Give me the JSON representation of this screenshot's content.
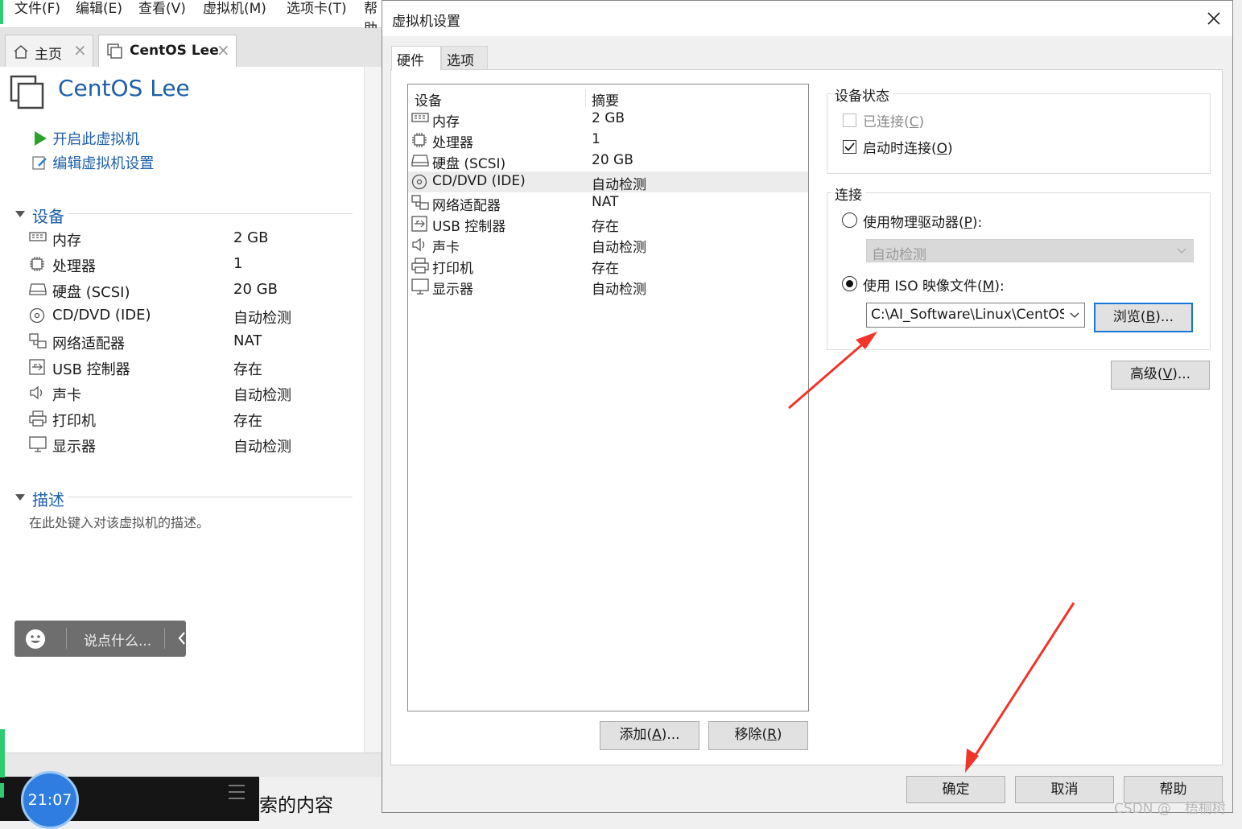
{
  "menubar": {
    "items": [
      "文件(F)",
      "编辑(E)",
      "查看(V)",
      "虚拟机(M)",
      "选项卡(T)",
      "帮助"
    ]
  },
  "tabs": [
    {
      "label": "主页"
    },
    {
      "label": "CentOS Lee"
    }
  ],
  "vm": {
    "title": "CentOS Lee",
    "actions": {
      "start": "开启此虚拟机",
      "edit": "编辑虚拟机设置"
    },
    "devices_title": "设备",
    "devices": [
      {
        "name": "内存",
        "value": "2 GB"
      },
      {
        "name": "处理器",
        "value": "1"
      },
      {
        "name": "硬盘 (SCSI)",
        "value": "20 GB"
      },
      {
        "name": "CD/DVD (IDE)",
        "value": "自动检测"
      },
      {
        "name": "网络适配器",
        "value": "NAT"
      },
      {
        "name": "USB 控制器",
        "value": "存在"
      },
      {
        "name": "声卡",
        "value": "自动检测"
      },
      {
        "name": "打印机",
        "value": "存在"
      },
      {
        "name": "显示器",
        "value": "自动检测"
      }
    ],
    "description_title": "描述",
    "description_placeholder": "在此处键入对该虚拟机的描述。"
  },
  "chat": {
    "placeholder": "说点什么..."
  },
  "taskbar": {
    "clock": "21:07",
    "search_text": "索的内容"
  },
  "dialog": {
    "title": "虚拟机设置",
    "tabs": {
      "hardware": "硬件",
      "options": "选项"
    },
    "list_headers": {
      "device": "设备",
      "summary": "摘要"
    },
    "devices": [
      {
        "name": "内存",
        "summary": "2 GB"
      },
      {
        "name": "处理器",
        "summary": "1"
      },
      {
        "name": "硬盘 (SCSI)",
        "summary": "20 GB"
      },
      {
        "name": "CD/DVD (IDE)",
        "summary": "自动检测"
      },
      {
        "name": "网络适配器",
        "summary": "NAT"
      },
      {
        "name": "USB 控制器",
        "summary": "存在"
      },
      {
        "name": "声卡",
        "summary": "自动检测"
      },
      {
        "name": "打印机",
        "summary": "存在"
      },
      {
        "name": "显示器",
        "summary": "自动检测"
      }
    ],
    "buttons": {
      "add": {
        "text": "添加(",
        "key": "A",
        "tail": ")..."
      },
      "remove": {
        "text": "移除(",
        "key": "R",
        "tail": ")"
      },
      "browse": {
        "text": "浏览(",
        "key": "B",
        "tail": ")..."
      },
      "advanced": {
        "text": "高级(",
        "key": "V",
        "tail": ")..."
      },
      "ok": "确定",
      "cancel": "取消",
      "help": "帮助"
    },
    "device_status": {
      "title": "设备状态",
      "connected": {
        "text": "已连接(",
        "key": "C",
        "tail": ")",
        "checked": false
      },
      "connect_at_power_on": {
        "text": "启动时连接(",
        "key": "O",
        "tail": ")",
        "checked": true
      }
    },
    "connection": {
      "title": "连接",
      "physical": {
        "text": "使用物理驱动器(",
        "key": "P",
        "tail": "):"
      },
      "physical_select": "自动检测",
      "iso": {
        "text": "使用 ISO 映像文件(",
        "key": "M",
        "tail": "):"
      },
      "iso_path": "C:\\AI_Software\\Linux\\CentOS-"
    }
  },
  "watermark": "CSDN @　梧桐树"
}
